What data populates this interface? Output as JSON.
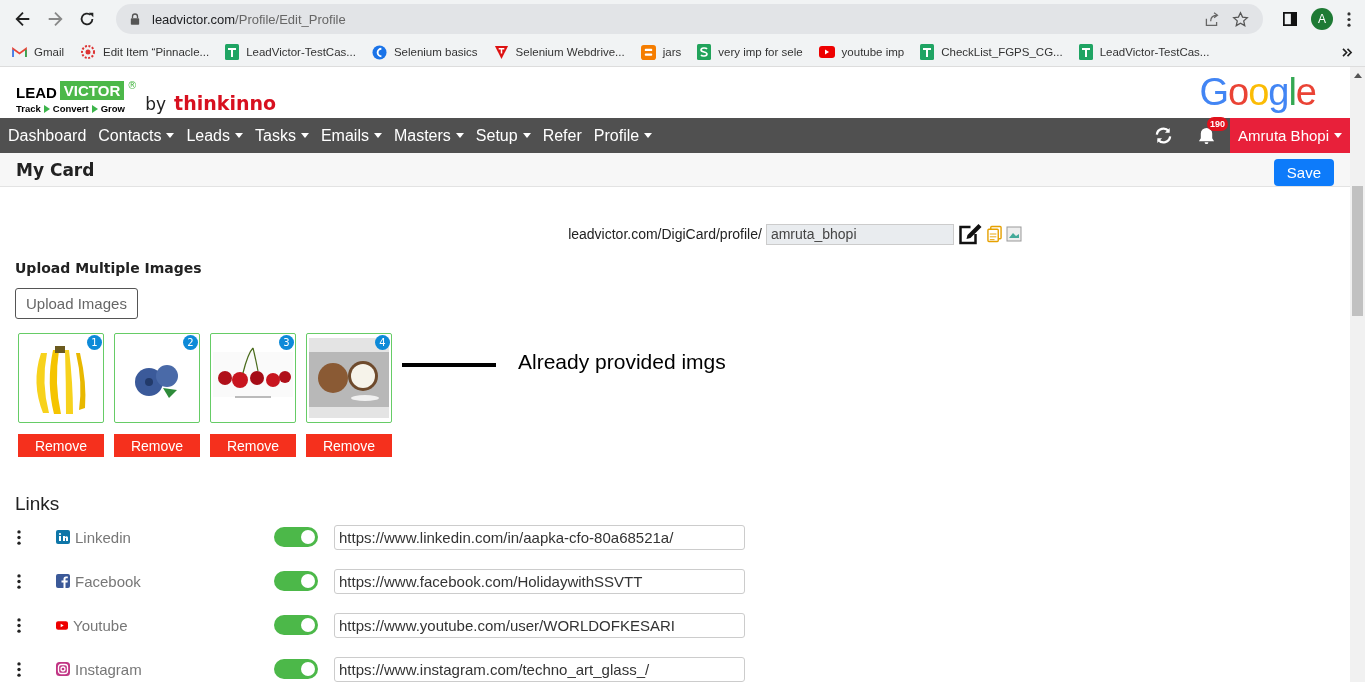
{
  "browser": {
    "url_host": "leadvictor.com",
    "url_path": "/Profile/Edit_Profile",
    "profile_initial": "A",
    "bookmarks": [
      {
        "kind": "gmail",
        "label": "Gmail"
      },
      {
        "kind": "edit",
        "label": "Edit Item “Pinnacle..."
      },
      {
        "kind": "sheet",
        "label": "LeadVictor-TestCas..."
      },
      {
        "kind": "selenium",
        "label": "Selenium basics"
      },
      {
        "kind": "triangle",
        "label": "Selenium Webdrive..."
      },
      {
        "kind": "blogger",
        "label": "jars"
      },
      {
        "kind": "s",
        "label": "very imp for sele"
      },
      {
        "kind": "youtube",
        "label": "youtube imp"
      },
      {
        "kind": "sheet",
        "label": "CheckList_FGPS_CG..."
      },
      {
        "kind": "sheet",
        "label": "LeadVictor-TestCas..."
      }
    ]
  },
  "logo": {
    "lead": "LEAD",
    "victor": "VICTOR",
    "registered": "®",
    "steps": [
      "Track",
      "Convert",
      "Grow"
    ],
    "by": "by",
    "company": "thinkinno"
  },
  "google_logo": "Google",
  "nav": {
    "items": [
      {
        "label": "Dashboard",
        "dropdown": false
      },
      {
        "label": "Contacts",
        "dropdown": true
      },
      {
        "label": "Leads",
        "dropdown": true
      },
      {
        "label": "Tasks",
        "dropdown": true
      },
      {
        "label": "Emails",
        "dropdown": true
      },
      {
        "label": "Masters",
        "dropdown": true
      },
      {
        "label": "Setup",
        "dropdown": true
      },
      {
        "label": "Refer",
        "dropdown": false
      },
      {
        "label": "Profile",
        "dropdown": true
      }
    ],
    "notification_count": "190",
    "user": "Amruta Bhopi"
  },
  "page": {
    "title": "My Card",
    "save": "Save"
  },
  "card_url": {
    "prefix": "leadvictor.com/DigiCard/profile/",
    "value": "amruta_bhopi"
  },
  "upload": {
    "heading": "Upload Multiple Images",
    "button": "Upload Images",
    "images": [
      {
        "kind": "picture",
        "number": "1",
        "remove": "Remove"
      },
      {
        "kind": "picture",
        "number": "2",
        "remove": "Remove"
      },
      {
        "kind": "picture",
        "number": "3",
        "remove": "Remove"
      },
      {
        "kind": "picture",
        "number": "4",
        "remove": "Remove"
      }
    ],
    "annotation": "Already provided imgs"
  },
  "links": {
    "heading": "Links",
    "items": [
      {
        "kind": "linkedin",
        "name": "Linkedin",
        "on": true,
        "url": "https://www.linkedin.com/in/aapka-cfo-80a68521a/"
      },
      {
        "kind": "facebook",
        "name": "Facebook",
        "on": true,
        "url": "https://www.facebook.com/HolidaywithSSVTT"
      },
      {
        "kind": "youtube",
        "name": "Youtube",
        "on": true,
        "url": "https://www.youtube.com/user/WORLDOFKESARI"
      },
      {
        "kind": "instagram",
        "name": "Instagram",
        "on": true,
        "url": "https://www.instagram.com/techno_art_glass_/"
      }
    ]
  }
}
